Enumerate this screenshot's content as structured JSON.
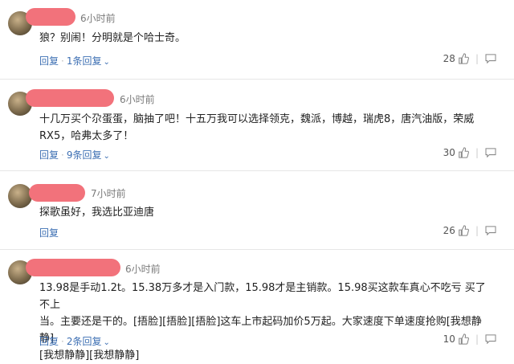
{
  "actions_labels": {
    "reply": "回复",
    "chev": "⌄"
  },
  "comments": [
    {
      "time": "6小时前",
      "lines": [
        "狼？别闹！分明就是个哈士奇。"
      ],
      "replies": "1条回复",
      "likes": "28"
    },
    {
      "time": "6小时前",
      "lines": [
        "十几万买个尕蛋蛋，脑抽了吧！十五万我可以选择领克，魏派，博越，瑞虎8，唐汽油版，荣威",
        "RX5，哈弗太多了！"
      ],
      "replies": "9条回复",
      "likes": "30"
    },
    {
      "time": "7小时前",
      "lines": [
        "探歌虽好，我选比亚迪唐"
      ],
      "replies": "",
      "likes": "26"
    },
    {
      "time": "6小时前",
      "lines": [
        "13.98是手动1.2t。15.38万多才是入门款，15.98才是主销款。15.98买这款车真心不吃亏 买了不上",
        "当。主要还是干的。[捂脸][捂脸][捂脸]这车上市起码加价5万起。大家速度下单速度抢购[我想静静]",
        "[我想静静][我想静静]"
      ],
      "replies": "2条回复",
      "likes": "10"
    }
  ]
}
